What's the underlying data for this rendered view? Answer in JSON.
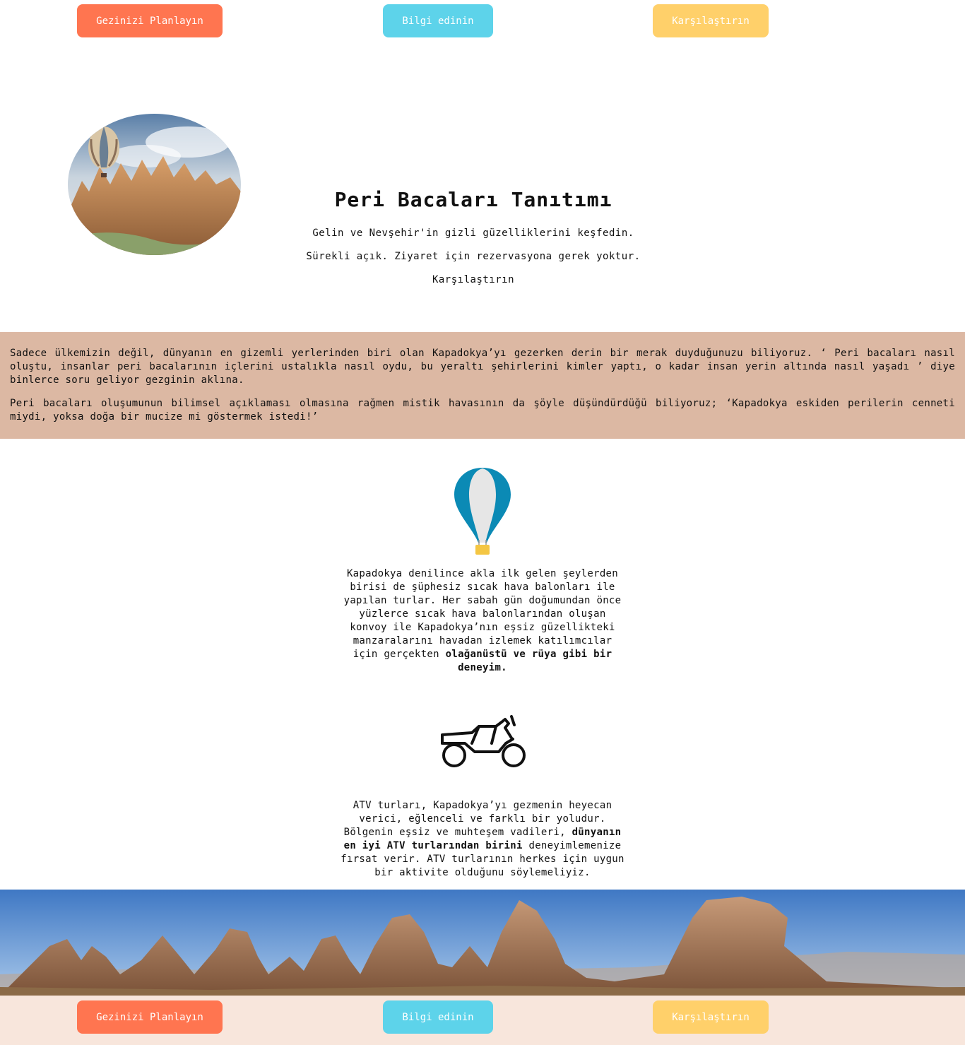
{
  "nav": {
    "plan_label": "Gezinizi Planlayın",
    "info_label": "Bilgi edinin",
    "compare_label": "Karşılaştırın"
  },
  "hero": {
    "title": "Peri Bacaları Tanıtımı",
    "line1": "Gelin ve Nevşehir'in gizli güzelliklerini keşfedin.",
    "line2": "Sürekli açık. Ziyaret için rezervasyona gerek yoktur.",
    "line3": "Karşılaştırın"
  },
  "intro": {
    "p1": "Sadece ülkemizin değil, dünyanın en gizemli yerlerinden biri olan Kapadokya’yı gezerken derin bir merak duyduğunuzu biliyoruz. ‘ Peri bacaları nasıl oluştu, insanlar peri bacalarının içlerini ustalıkla nasıl oydu, bu yeraltı şehirlerini kimler yaptı, o kadar insan yerin altında nasıl yaşadı ’ diye binlerce soru geliyor gezginin aklına.",
    "p2": "Peri bacaları oluşumunun bilimsel açıklaması olmasına rağmen mistik havasının da şöyle düşündürdüğü biliyoruz; ‘Kapadokya eskiden perilerin cenneti miydi, yoksa doğa bir mucize mi göstermek istedi!’"
  },
  "balloon": {
    "icon": "hot-air-balloon-icon",
    "text": "Kapadokya denilince akla ilk gelen şeylerden birisi de şüphesiz sıcak hava balonları ile yapılan turlar. Her sabah gün doğumundan önce yüzlerce sıcak hava balonlarından oluşan konvoy ile Kapadokya’nın eşsiz güzellikteki manzaralarını havadan izlemek katılımcılar için gerçekten ",
    "bold": "olağanüstü ve rüya gibi bir deneyim."
  },
  "atv": {
    "icon": "atv-icon",
    "text_a": "ATV turları, Kapadokya’yı gezmenin heyecan verici, eğlenceli ve farklı bir yoludur. Bölgenin eşsiz ve muhteşem vadileri, ",
    "bold": "dünyanın en iyi ATV turlarından birini",
    "text_b": " deneyimlemenize fırsat verir. ATV turlarının herkes için uygun bir aktivite olduğunu söylemeliyiz."
  },
  "colors": {
    "orange": "#ff7550",
    "cyan": "#5dd3ea",
    "yellow": "#ffd06a",
    "band": "#dcb8a3",
    "footer": "#f8e6dc"
  }
}
